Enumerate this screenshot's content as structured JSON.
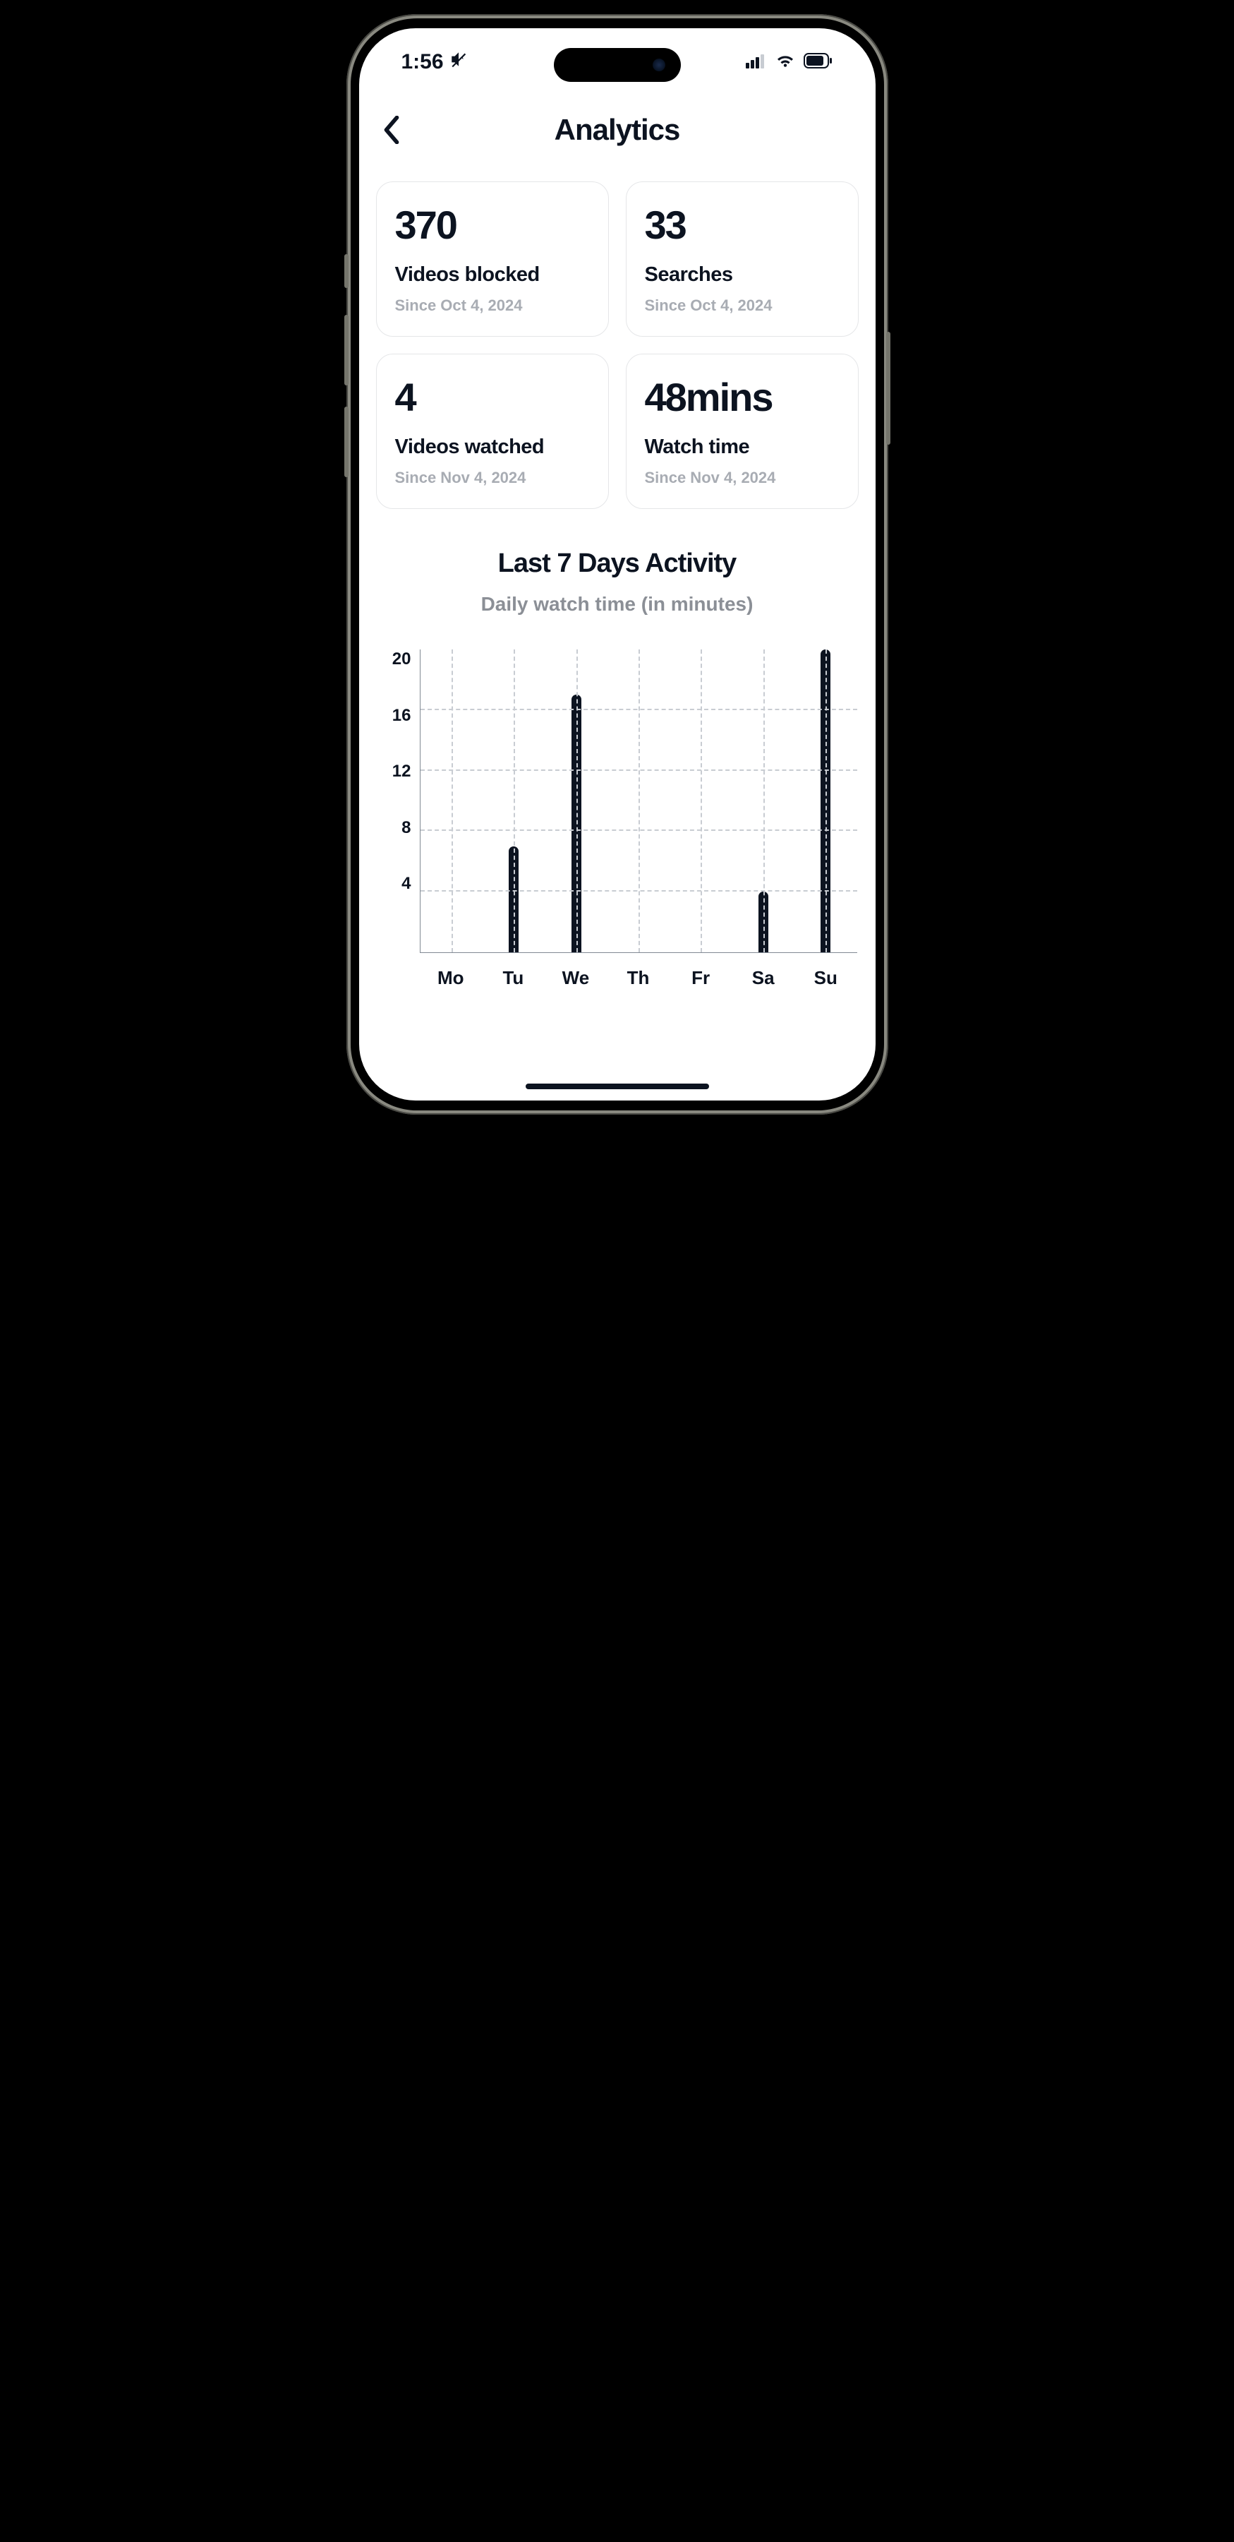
{
  "statusbar": {
    "time": "1:56"
  },
  "header": {
    "title": "Analytics"
  },
  "cards": [
    {
      "value": "370",
      "label": "Videos blocked",
      "sub": "Since Oct 4, 2024"
    },
    {
      "value": "33",
      "label": "Searches",
      "sub": "Since Oct 4, 2024"
    },
    {
      "value": "4",
      "label": "Videos watched",
      "sub": "Since Nov 4, 2024"
    },
    {
      "value": "48mins",
      "label": "Watch time",
      "sub": "Since Nov 4, 2024"
    }
  ],
  "chart": {
    "title": "Last 7 Days Activity",
    "subtitle": "Daily watch time (in minutes)",
    "yticks": [
      "20",
      "16",
      "12",
      "8",
      "4"
    ]
  },
  "chart_data": {
    "type": "bar",
    "title": "Last 7 Days Activity",
    "subtitle": "Daily watch time (in minutes)",
    "xlabel": "",
    "ylabel": "Daily watch time (in minutes)",
    "ylim": [
      0,
      20
    ],
    "categories": [
      "Mo",
      "Tu",
      "We",
      "Th",
      "Fr",
      "Sa",
      "Su"
    ],
    "values": [
      0,
      7,
      17,
      0,
      0,
      4,
      20
    ]
  }
}
